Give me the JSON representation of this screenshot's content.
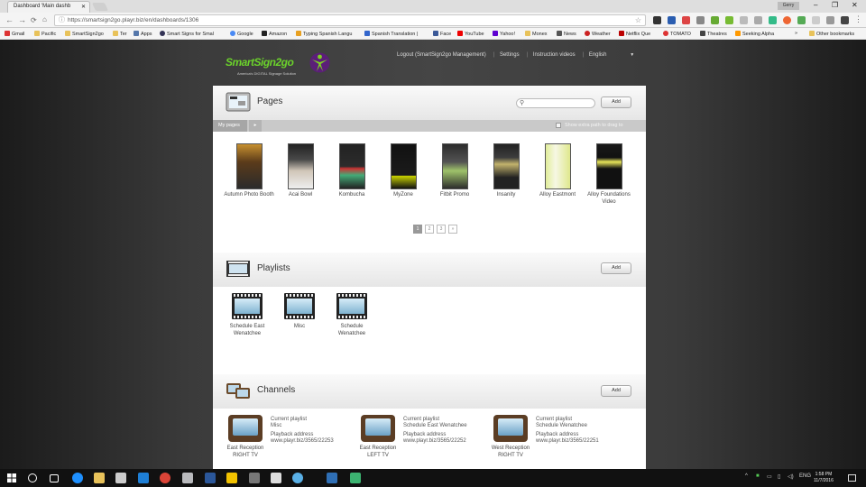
{
  "browser": {
    "tab_title": "Dashboard 'Main dashb",
    "user_badge": "Gerry",
    "url": "https://smartsign2go.playr.biz/en/dashboards/1306",
    "bookmarks": [
      "Gmail",
      "Pacific",
      "SmartSign2go",
      "Ter",
      "Apps",
      "Smart Signs for Smal",
      "Google",
      "Amazon",
      "Typing Spanish Langu",
      "Spanish Translation |",
      "Face",
      "YouTube",
      "Yahoo!",
      "Monex",
      "News",
      "Weather",
      "Netflix Que",
      "TOMATO",
      "Theatres",
      "Seeking Alpha"
    ],
    "other_bookmarks": "Other bookmarks",
    "more": "»"
  },
  "site": {
    "logo_text": "SmartSign2go",
    "logo_tagline": "America's DIGITAL Signage Solution",
    "nav": {
      "logout": "Logout (SmartSign2go Management)",
      "settings": "Settings",
      "instructions": "Instruction videos",
      "language": "English"
    }
  },
  "pages": {
    "title": "Pages",
    "add_label": "Add",
    "search_placeholder": "",
    "my_pages": "My pages",
    "show_extra": "Show extra path to drag to",
    "items": [
      {
        "label": "Autumn Photo Booth",
        "color": "#7a4a22"
      },
      {
        "label": "Acai Bowl",
        "color": "#3a3a3a"
      },
      {
        "label": "Kombucha",
        "color": "#2b2b2b"
      },
      {
        "label": "MyZone",
        "color": "#181818"
      },
      {
        "label": "Fitbit Promo",
        "color": "#2f2f2f"
      },
      {
        "label": "Insanity",
        "color": "#3b3b3b"
      },
      {
        "label": "Alloy Eastmont",
        "color": "#d8e7a1"
      },
      {
        "label": "Alloy Foundations Video",
        "color": "#1d1d1d"
      }
    ],
    "pager": [
      "1",
      "2",
      "3",
      "»"
    ]
  },
  "playlists": {
    "title": "Playlists",
    "add_label": "Add",
    "items": [
      "Schedule East Wenatchee",
      "Misc",
      "Schedule Wenatchee"
    ]
  },
  "channels": {
    "title": "Channels",
    "add_label": "Add",
    "current_label": "Current playlist",
    "playback_label": "Playback address",
    "items": [
      {
        "name": "East Reception RIGHT TV",
        "playlist": "Misc",
        "address": "www.playr.biz/3565/22253"
      },
      {
        "name": "East Reception LEFT TV",
        "playlist": "Schedule East Wenatchee",
        "address": "www.playr.biz/3565/22252"
      },
      {
        "name": "West Reception RIGHT TV",
        "playlist": "Schedule Wenatchee",
        "address": "www.playr.biz/3565/22251"
      }
    ]
  },
  "taskbar": {
    "lang": "ENG",
    "time": "1:58 PM",
    "date": "11/7/2016"
  },
  "colors": {
    "brand_green": "#6bd22b",
    "accent_purple": "#7a2a9a"
  }
}
